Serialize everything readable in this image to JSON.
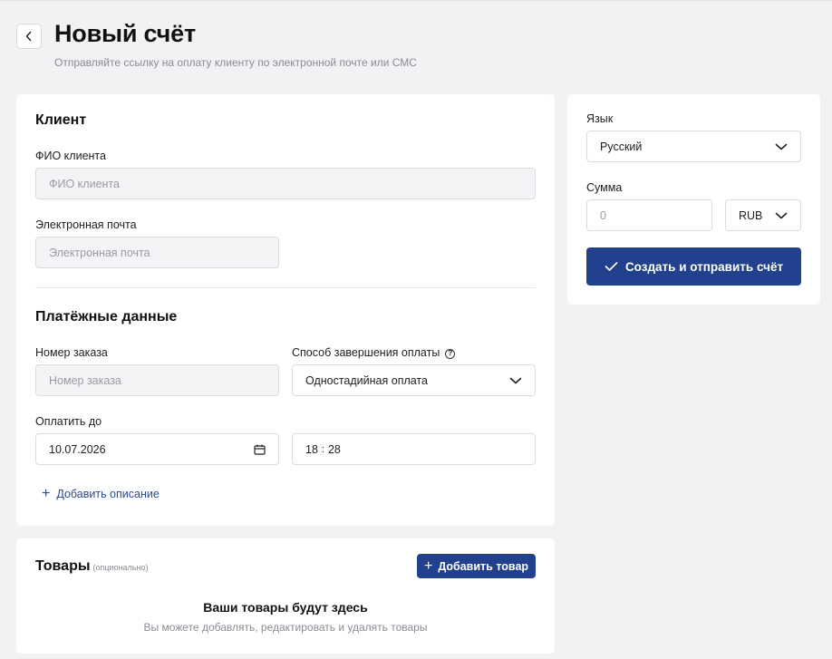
{
  "header": {
    "title": "Новый счёт",
    "subtitle": "Отправляйте ссылку на оплату клиенту по электронной почте или СМС"
  },
  "client": {
    "section_title": "Клиент",
    "name_label": "ФИО клиента",
    "name_placeholder": "ФИО клиента",
    "email_label": "Электронная почта",
    "email_placeholder": "Электронная почта"
  },
  "payment": {
    "section_title": "Платёжные данные",
    "order_label": "Номер заказа",
    "order_placeholder": "Номер заказа",
    "method_label": "Способ завершения оплаты",
    "method_value": "Одностадийная оплата",
    "pay_until_label": "Оплатить до",
    "date_value": "10.07.2026",
    "time_hours": "18",
    "time_sep": ":",
    "time_minutes": "28",
    "add_description": "Добавить описание"
  },
  "goods": {
    "title": "Товары",
    "optional": "(опционально)",
    "add_button": "Добавить товар",
    "empty_title": "Ваши товары будут здесь",
    "empty_subtitle": "Вы можете добавлять, редактировать и удалять товары"
  },
  "sidebar": {
    "language_label": "Язык",
    "language_value": "Русский",
    "amount_label": "Сумма",
    "amount_placeholder": "0",
    "currency_value": "RUB",
    "submit_button": "Создать и отправить счёт"
  },
  "colors": {
    "primary": "#21418f",
    "background": "#f2f2f4",
    "link": "#2b4a8c"
  },
  "icons": {
    "back": "chevron-left-icon",
    "dropdown": "chevron-down-icon",
    "help": "question-circle-icon",
    "calendar": "calendar-icon",
    "plus": "plus-icon",
    "check": "check-icon"
  }
}
